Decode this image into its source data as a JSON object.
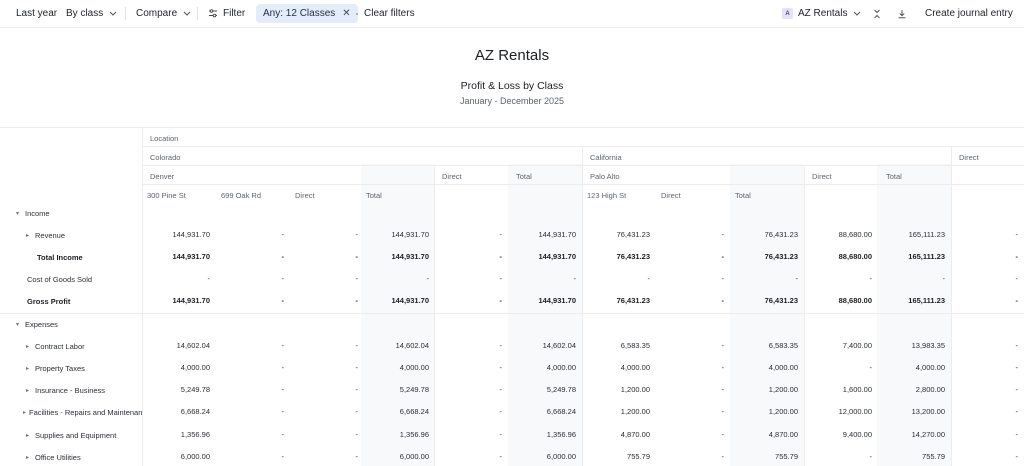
{
  "toolbar": {
    "period": "Last year",
    "group_by": "By class",
    "compare": "Compare",
    "filter": "Filter",
    "active_filter": "Any: 12 Classes",
    "clear_filters": "Clear filters",
    "company_selector": "AZ Rentals",
    "company_badge": "A",
    "create_entry": "Create journal entry"
  },
  "report": {
    "company": "AZ Rentals",
    "title": "Profit & Loss by Class",
    "period": "January - December 2025"
  },
  "headers": {
    "location": "Location",
    "colorado": "Colorado",
    "california": "California",
    "direct_top": "Direct",
    "denver": "Denver",
    "co_direct": "Direct",
    "co_total": "Total",
    "palo_alto": "Palo Alto",
    "ca_direct": "Direct",
    "ca_total": "Total",
    "cols": [
      "300 Pine St",
      "699 Oak Rd",
      "Direct",
      "Total",
      "",
      "",
      "123 High St",
      "Direct",
      "Total",
      "",
      "",
      ""
    ]
  },
  "rows": [
    {
      "label": "Income",
      "caret": "▾",
      "indent": 0,
      "bold": false,
      "values": [
        "",
        "",
        "",
        "",
        "",
        "",
        "",
        "",
        "",
        "",
        "",
        ""
      ]
    },
    {
      "label": "Revenue",
      "caret": "▸",
      "indent": 1,
      "bold": false,
      "values": [
        "144,931.70",
        "-",
        "-",
        "144,931.70",
        "-",
        "144,931.70",
        "76,431.23",
        "-",
        "76,431.23",
        "88,680.00",
        "165,111.23",
        "-"
      ]
    },
    {
      "label": "Total Income",
      "caret": "",
      "indent": 1,
      "bold": true,
      "values": [
        "144,931.70",
        "-",
        "-",
        "144,931.70",
        "-",
        "144,931.70",
        "76,431.23",
        "-",
        "76,431.23",
        "88,680.00",
        "165,111.23",
        "-"
      ]
    },
    {
      "label": "Cost of Goods Sold",
      "caret": "",
      "indent": 0,
      "bold": false,
      "values": [
        "-",
        "-",
        "-",
        "-",
        "-",
        "-",
        "-",
        "-",
        "-",
        "-",
        "-",
        "-"
      ]
    },
    {
      "label": "Gross Profit",
      "caret": "",
      "indent": 0,
      "bold": true,
      "values": [
        "144,931.70",
        "-",
        "-",
        "144,931.70",
        "-",
        "144,931.70",
        "76,431.23",
        "-",
        "76,431.23",
        "88,680.00",
        "165,111.23",
        "-"
      ]
    },
    {
      "label": "Expenses",
      "caret": "▾",
      "indent": 0,
      "bold": false,
      "values": [
        "",
        "",
        "",
        "",
        "",
        "",
        "",
        "",
        "",
        "",
        "",
        ""
      ]
    },
    {
      "label": "Contract Labor",
      "caret": "▸",
      "indent": 1,
      "bold": false,
      "values": [
        "14,602.04",
        "-",
        "-",
        "14,602.04",
        "-",
        "14,602.04",
        "6,583.35",
        "-",
        "6,583.35",
        "7,400.00",
        "13,983.35",
        "-"
      ]
    },
    {
      "label": "Property Taxes",
      "caret": "▸",
      "indent": 1,
      "bold": false,
      "values": [
        "4,000.00",
        "-",
        "-",
        "4,000.00",
        "-",
        "4,000.00",
        "4,000.00",
        "-",
        "4,000.00",
        "-",
        "4,000.00",
        "-"
      ]
    },
    {
      "label": "Insurance - Business",
      "caret": "▸",
      "indent": 1,
      "bold": false,
      "values": [
        "5,249.78",
        "-",
        "-",
        "5,249.78",
        "-",
        "5,249.78",
        "1,200.00",
        "-",
        "1,200.00",
        "1,600.00",
        "2,800.00",
        "-"
      ]
    },
    {
      "label": "Facilities - Repairs and Maintenance",
      "caret": "▸",
      "indent": 1,
      "bold": false,
      "values": [
        "6,668.24",
        "-",
        "-",
        "6,668.24",
        "-",
        "6,668.24",
        "1,200.00",
        "-",
        "1,200.00",
        "12,000.00",
        "13,200.00",
        "-"
      ]
    },
    {
      "label": "Supplies and Equipment",
      "caret": "▸",
      "indent": 1,
      "bold": false,
      "values": [
        "1,356.96",
        "-",
        "-",
        "1,356.96",
        "-",
        "1,356.96",
        "4,870.00",
        "-",
        "4,870.00",
        "9,400.00",
        "14,270.00",
        "-"
      ]
    },
    {
      "label": "Office Utilities",
      "caret": "▸",
      "indent": 1,
      "bold": false,
      "values": [
        "6,000.00",
        "-",
        "-",
        "6,000.00",
        "-",
        "6,000.00",
        "755.79",
        "-",
        "755.79",
        "-",
        "755.79",
        "-"
      ]
    }
  ],
  "colors": {
    "filter_pill": "#e3ecf9",
    "total_column_shade": "#f7f9fb",
    "grid": "#ececec"
  },
  "icons": [
    "chevron-down-icon",
    "filter-sliders-icon",
    "close-icon",
    "collapse-icon",
    "download-icon",
    "caret-right-icon",
    "caret-down-icon"
  ]
}
